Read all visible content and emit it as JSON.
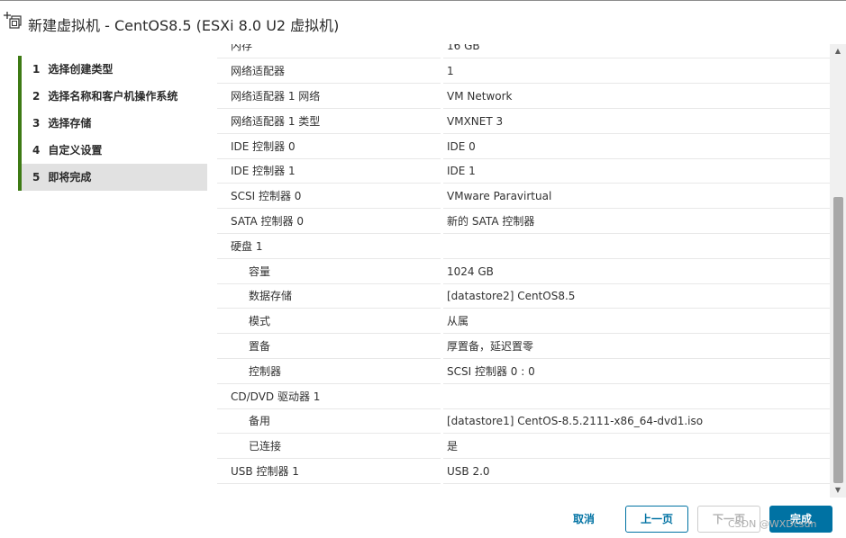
{
  "window": {
    "title": "新建虚拟机 - CentOS8.5 (ESXi 8.0 U2 虚拟机)"
  },
  "steps": [
    {
      "num": "1",
      "label": "选择创建类型"
    },
    {
      "num": "2",
      "label": "选择名称和客户机操作系统"
    },
    {
      "num": "3",
      "label": "选择存储"
    },
    {
      "num": "4",
      "label": "自定义设置"
    },
    {
      "num": "5",
      "label": "即将完成"
    }
  ],
  "active_step": 5,
  "summary": [
    {
      "label": "内存",
      "value": "16 GB"
    },
    {
      "label": "网络适配器",
      "value": "1"
    },
    {
      "label": "网络适配器 1 网络",
      "value": "VM Network"
    },
    {
      "label": "网络适配器 1 类型",
      "value": "VMXNET 3"
    },
    {
      "label": "IDE 控制器 0",
      "value": "IDE 0"
    },
    {
      "label": "IDE 控制器 1",
      "value": "IDE 1"
    },
    {
      "label": "SCSI 控制器 0",
      "value": "VMware Paravirtual"
    },
    {
      "label": "SATA 控制器 0",
      "value": "新的 SATA 控制器"
    },
    {
      "label": "硬盘 1",
      "value": ""
    },
    {
      "label": "容量",
      "value": "1024 GB"
    },
    {
      "label": "数据存储",
      "value": "[datastore2] CentOS8.5"
    },
    {
      "label": "模式",
      "value": "从属"
    },
    {
      "label": "置备",
      "value": "厚置备，延迟置零"
    },
    {
      "label": "控制器",
      "value": "SCSI 控制器 0 : 0"
    },
    {
      "label": "CD/DVD 驱动器 1",
      "value": ""
    },
    {
      "label": "备用",
      "value": "[datastore1] CentOS-8.5.2111-x86_64-dvd1.iso"
    },
    {
      "label": "已连接",
      "value": "是"
    },
    {
      "label": "USB 控制器 1",
      "value": "USB 2.0"
    }
  ],
  "buttons": {
    "cancel": "取消",
    "back": "上一页",
    "next": "下一页",
    "finish": "完成"
  },
  "watermark": "CSDN @WXDcsdn",
  "colors": {
    "accent": "#0072a3",
    "step_bar": "#3d7a14",
    "active_step_bg": "#e1e1e1"
  },
  "icons": {
    "title": "new-vm-icon",
    "scroll_up": "triangle-up-icon",
    "scroll_down": "triangle-down-icon"
  }
}
